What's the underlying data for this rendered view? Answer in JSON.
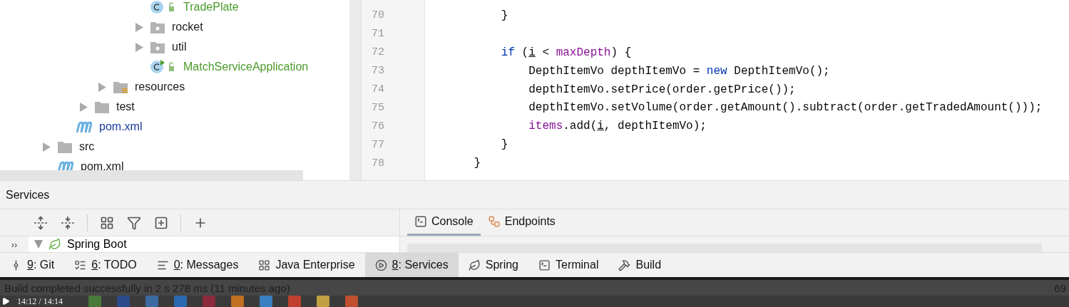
{
  "project_tree": [
    {
      "children": [
        {
          "children": [
            {
              "children": [
                {
                  "children": [
                    {
                      "children": [
                        {
                          "label": "TradePlate",
                          "kind": "class",
                          "color": "#4a9a2a"
                        },
                        {
                          "label": "rocket",
                          "kind": "package",
                          "color": "#1a1a1a"
                        },
                        {
                          "label": "util",
                          "kind": "package",
                          "color": "#1a1a1a"
                        },
                        {
                          "label": "MatchServiceApplication",
                          "kind": "boot-class",
                          "color": "#4a9a2a"
                        }
                      ]
                    }
                  ]
                },
                {
                  "label": "resources",
                  "kind": "resources",
                  "color": "#1a1a1a"
                }
              ]
            },
            {
              "label": "test",
              "kind": "folder",
              "color": "#1a1a1a"
            }
          ]
        },
        {
          "label": "pom.xml",
          "kind": "maven",
          "color": "#1a3aa0"
        }
      ]
    },
    {
      "label": "src",
      "kind": "folder",
      "color": "#1a1a1a"
    },
    {
      "label": "pom.xml",
      "kind": "maven",
      "color": "#1a1a1a"
    }
  ],
  "editor": {
    "lines": [
      {
        "number": "70",
        "tokens": [
          {
            "kind": "plain",
            "text": "        }"
          }
        ]
      },
      {
        "number": "71"
      },
      {
        "number": "72",
        "tokens": [
          {
            "kind": "keyword",
            "text": "        if"
          },
          {
            "kind": "plain",
            "text": " ("
          },
          {
            "kind": "var",
            "text": "i"
          },
          {
            "kind": "plain",
            "text": " < "
          },
          {
            "kind": "field",
            "text": "maxDepth"
          },
          {
            "kind": "plain",
            "text": ") {"
          }
        ]
      },
      {
        "number": "73",
        "tokens": [
          {
            "kind": "plain",
            "text": "            DepthItemVo depthItemVo = "
          },
          {
            "kind": "keyword",
            "text": "new"
          },
          {
            "kind": "plain",
            "text": " DepthItemVo();"
          }
        ]
      },
      {
        "number": "74",
        "tokens": [
          {
            "kind": "plain",
            "text": "            depthItemVo.setPrice(order.getPrice());"
          }
        ]
      },
      {
        "number": "75",
        "tokens": [
          {
            "kind": "plain",
            "text": "            depthItemVo.setVolume(order.getAmount().subtract(order.getTradedAmount()));"
          }
        ]
      },
      {
        "number": "76",
        "tokens": [
          {
            "kind": "field",
            "text": "            items"
          },
          {
            "kind": "plain",
            "text": ".add("
          },
          {
            "kind": "var",
            "text": "i"
          },
          {
            "kind": "plain",
            "text": ", depthItemVo);"
          }
        ]
      },
      {
        "number": "77",
        "tokens": [
          {
            "kind": "plain",
            "text": "        }"
          }
        ]
      },
      {
        "number": "78",
        "tokens": [
          {
            "kind": "plain",
            "text": "    }"
          }
        ]
      }
    ]
  },
  "services": {
    "title": "Services",
    "tabs": [
      {
        "label": "Console",
        "selected": true
      },
      {
        "label": "Endpoints",
        "selected": false
      }
    ],
    "tree_item": {
      "label": "Spring Boot",
      "expanded": true
    },
    "collapsed_marker": "››"
  },
  "tool_windows": [
    {
      "key": "9",
      "label": ": Git",
      "selected": false
    },
    {
      "key": "6",
      "label": ": TODO",
      "selected": false
    },
    {
      "key": "0",
      "label": ": Messages",
      "selected": false
    },
    {
      "label": "Java Enterprise",
      "selected": false
    },
    {
      "key": "8",
      "label": ": Services",
      "selected": true
    },
    {
      "label": "Spring",
      "selected": false
    },
    {
      "label": "Terminal",
      "selected": false
    },
    {
      "label": "Build",
      "selected": false
    }
  ],
  "status_bar": {
    "message": "Build completed successfully in 2 s 278 ms (11 minutes ago)",
    "line": "69"
  },
  "player": {
    "time": "14:12 / 14:14"
  }
}
